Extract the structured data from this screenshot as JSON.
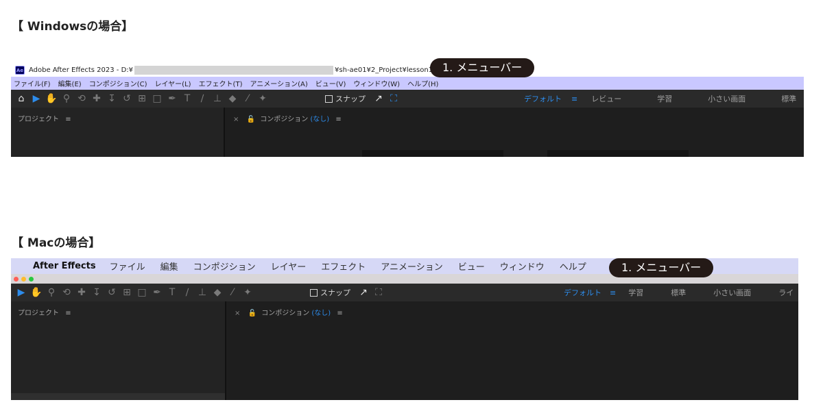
{
  "windows": {
    "heading": "【 Windowsの場合】",
    "title_prefix": "Adobe After Effects 2023 - D:¥",
    "title_suffix": "¥sh-ae01¥2_Project¥lesson1.aep",
    "ae_logo": "Ae",
    "menu": [
      "ファイル(F)",
      "編集(E)",
      "コンポジション(C)",
      "レイヤー(L)",
      "エフェクト(T)",
      "アニメーション(A)",
      "ビュー(V)",
      "ウィンドウ(W)",
      "ヘルプ(H)"
    ],
    "callout": "1. メニューバー",
    "snap_label": "スナップ",
    "workspaces": [
      "デフォルト",
      "≡",
      "レビュー",
      "学習",
      "小さい画面",
      "標準"
    ],
    "project_panel": "プロジェクト",
    "panel_menu": "≡",
    "comp_close": "×",
    "comp_label": "コンポジション",
    "comp_none": "(なし)"
  },
  "mac": {
    "heading": "【 Macの場合】",
    "apple": "",
    "app_name": "After Effects",
    "menu": [
      "ファイル",
      "編集",
      "コンポジション",
      "レイヤー",
      "エフェクト",
      "アニメーション",
      "ビュー",
      "ウィンドウ",
      "ヘルプ"
    ],
    "callout": "1. メニューバー",
    "snap_label": "スナップ",
    "workspaces": [
      "デフォルト",
      "≡",
      "学習",
      "標準",
      "小さい画面",
      "ライ"
    ],
    "project_panel": "プロジェクト",
    "panel_menu": "≡",
    "comp_close": "×",
    "comp_label": "コンポジション",
    "comp_none": "(なし)"
  },
  "colors": {
    "menubar_win": "#c9c8ff",
    "menubar_mac": "#d6d8f6",
    "callout_bg": "#241a17",
    "accent_blue": "#2d8ceb"
  },
  "icons": [
    "home-icon",
    "selection-tool-icon",
    "hand-tool-icon",
    "zoom-tool-icon",
    "orbit-icon",
    "pan-icon",
    "dolly-icon",
    "rotate-icon",
    "camera-icon",
    "rectangle-tool-icon",
    "pen-tool-icon",
    "text-tool-icon",
    "brush-tool-icon",
    "clone-stamp-icon",
    "eraser-icon",
    "roto-brush-icon",
    "puppet-pin-icon",
    "snap-icon"
  ]
}
